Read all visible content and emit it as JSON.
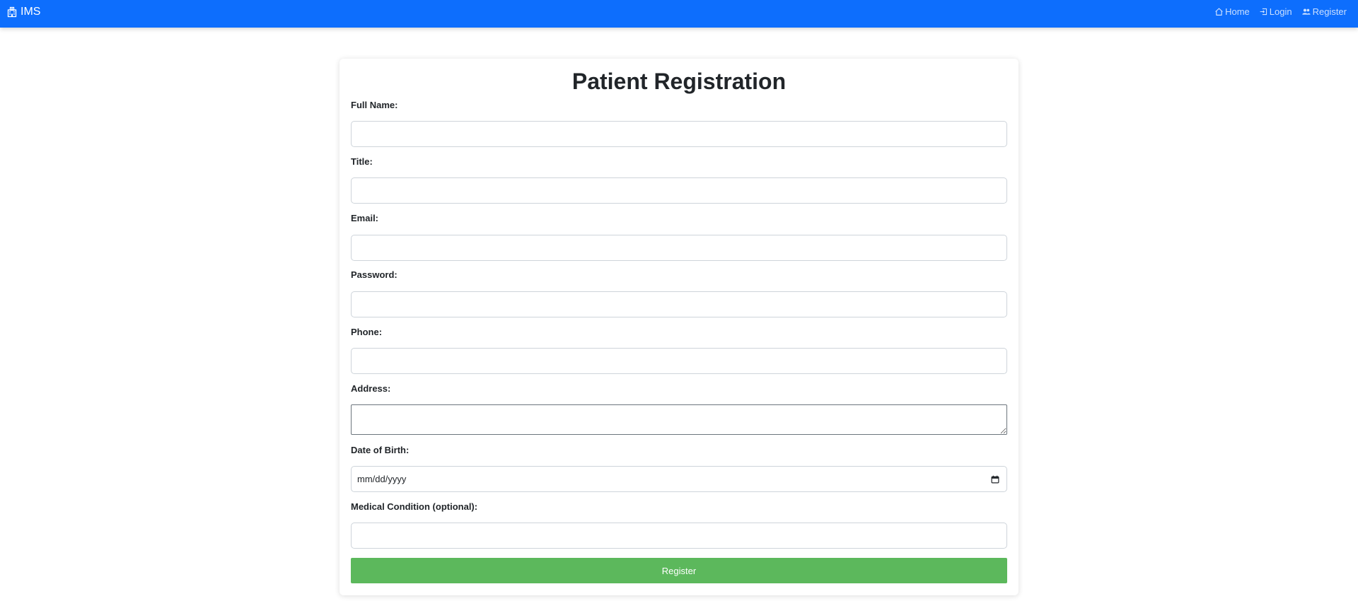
{
  "navbar": {
    "brand_label": "IMS",
    "brand_icon": "hospital-icon",
    "links": [
      {
        "label": "Home",
        "icon": "house-icon"
      },
      {
        "label": "Login",
        "icon": "box-arrow-in-icon"
      },
      {
        "label": "Register",
        "icon": "people-icon"
      }
    ]
  },
  "form": {
    "title": "Patient Registration",
    "fields": {
      "full_name": {
        "label": "Full Name:",
        "value": ""
      },
      "title": {
        "label": "Title:",
        "value": ""
      },
      "email": {
        "label": "Email:",
        "value": ""
      },
      "password": {
        "label": "Password:",
        "value": ""
      },
      "phone": {
        "label": "Phone:",
        "value": ""
      },
      "address": {
        "label": "Address:",
        "value": ""
      },
      "dob": {
        "label": "Date of Birth:",
        "placeholder": "mm/dd/yyyy"
      },
      "medical_condition": {
        "label": "Medical Condition (optional):",
        "value": ""
      }
    },
    "submit_label": "Register"
  },
  "colors": {
    "navbar_bg": "#0d6efd",
    "submit_bg": "#5cb85c"
  }
}
